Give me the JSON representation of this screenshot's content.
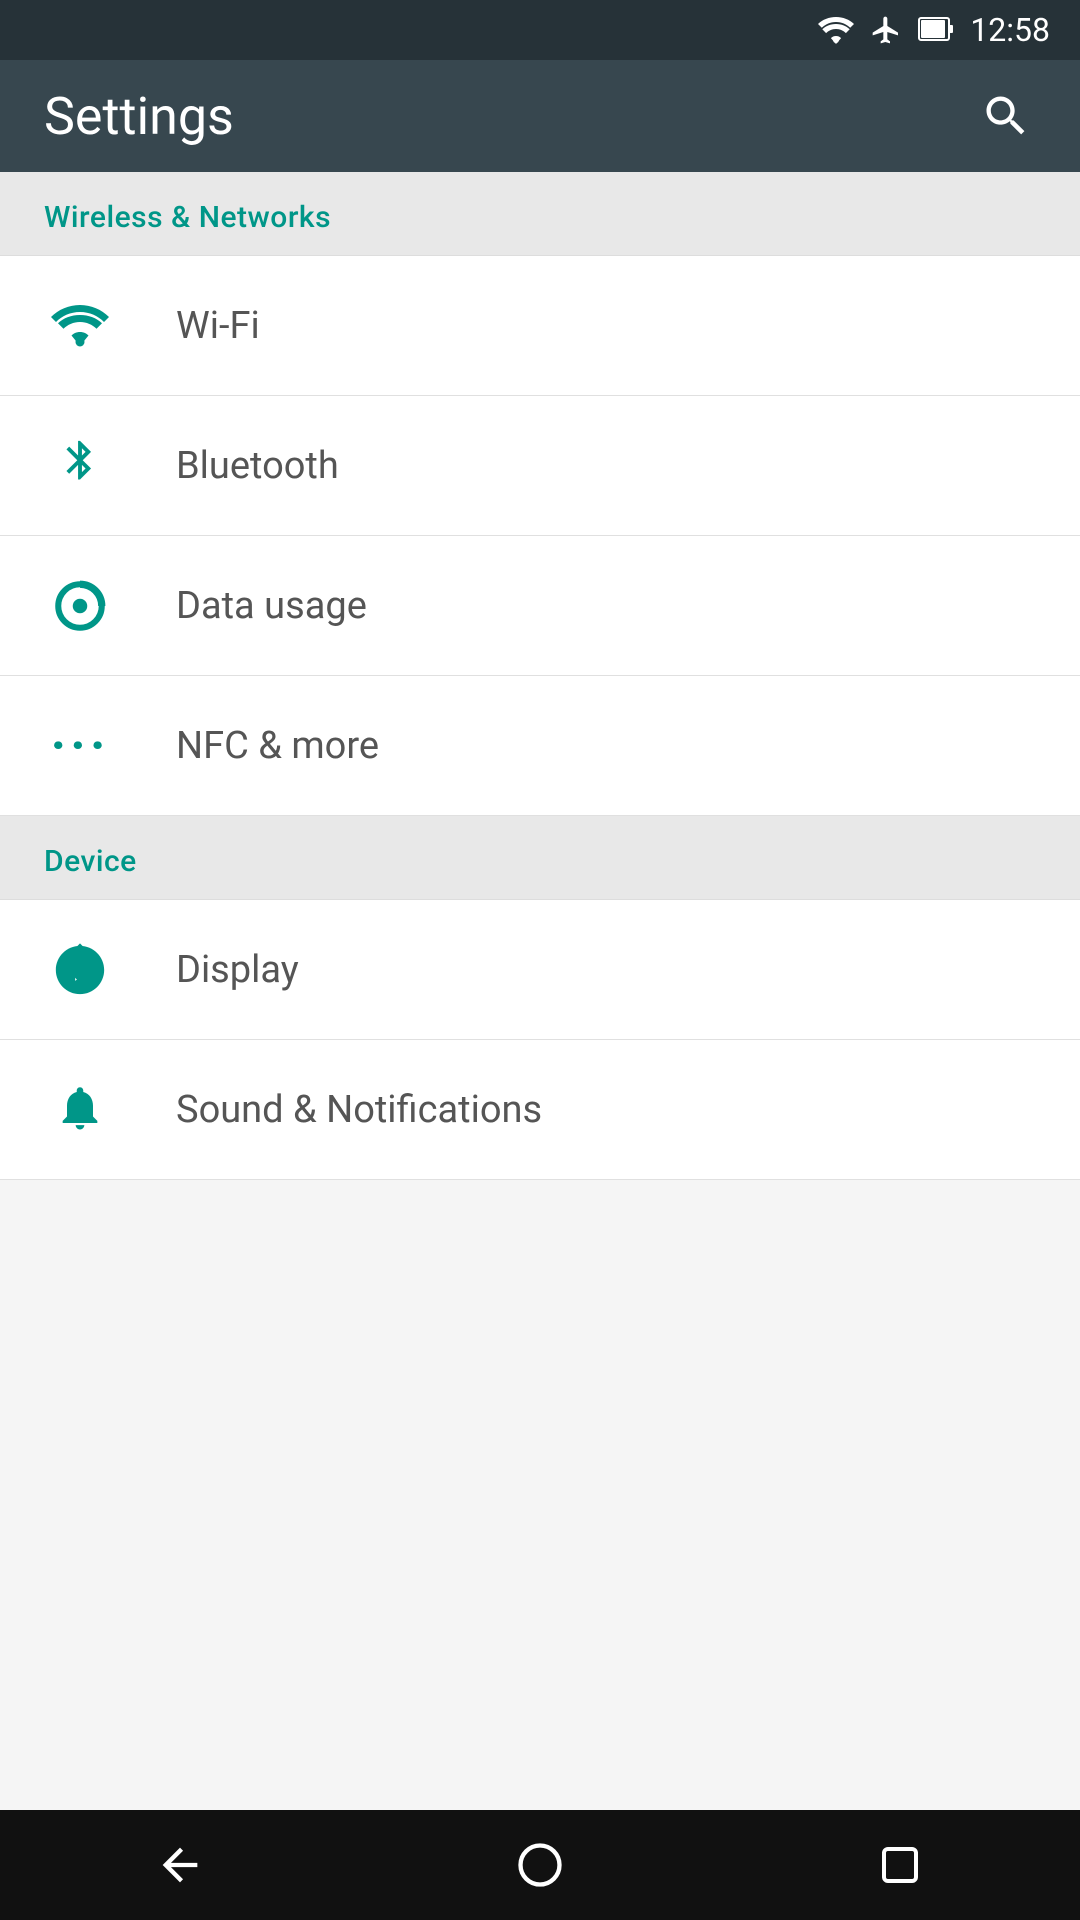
{
  "statusBar": {
    "time": "12:58"
  },
  "appBar": {
    "title": "Settings",
    "searchLabel": "Search"
  },
  "sections": [
    {
      "id": "wireless",
      "header": "Wireless & Networks",
      "items": [
        {
          "id": "wifi",
          "label": "Wi-Fi",
          "icon": "wifi-icon"
        },
        {
          "id": "bluetooth",
          "label": "Bluetooth",
          "icon": "bluetooth-icon"
        },
        {
          "id": "data-usage",
          "label": "Data usage",
          "icon": "data-usage-icon"
        },
        {
          "id": "nfc",
          "label": "NFC & more",
          "icon": "nfc-icon"
        }
      ]
    },
    {
      "id": "device",
      "header": "Device",
      "items": [
        {
          "id": "display",
          "label": "Display",
          "icon": "display-icon"
        },
        {
          "id": "sound",
          "label": "Sound & Notifications",
          "icon": "sound-icon"
        }
      ]
    }
  ],
  "navBar": {
    "back": "Back",
    "home": "Home",
    "recents": "Recents"
  }
}
